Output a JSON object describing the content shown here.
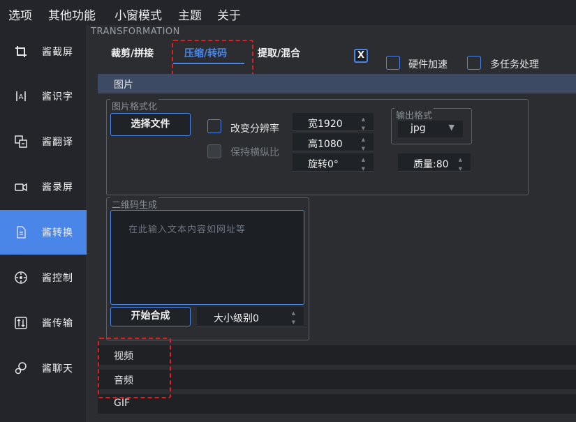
{
  "menu": [
    "选项",
    "其他功能",
    "小窗模式",
    "主题",
    "关于"
  ],
  "sidebar": {
    "items": [
      {
        "label": "酱截屏",
        "icon": "crop-icon"
      },
      {
        "label": "酱识字",
        "icon": "text-recognize-icon"
      },
      {
        "label": "酱翻译",
        "icon": "translate-icon"
      },
      {
        "label": "酱录屏",
        "icon": "video-camera-icon"
      },
      {
        "label": "酱转换",
        "icon": "file-convert-icon",
        "active": true
      },
      {
        "label": "酱控制",
        "icon": "remote-control-icon"
      },
      {
        "label": "酱传输",
        "icon": "transfer-icon"
      },
      {
        "label": "酱聊天",
        "icon": "chat-icon"
      }
    ]
  },
  "panel": {
    "title": "TRANSFORMATION",
    "tabs": [
      "裁剪/拼接",
      "压缩/转码",
      "提取/混合"
    ],
    "close_box": "X",
    "options": {
      "hardware_accel": "硬件加速",
      "multitask": "多任务处理"
    }
  },
  "sections": {
    "image": "图片",
    "video": "视频",
    "audio": "音频",
    "gif": "GIF"
  },
  "image_format": {
    "group_title": "图片格式化",
    "select_file": "选择文件",
    "change_resolution": "改变分辨率",
    "keep_ratio": "保持横纵比",
    "width": "宽1920",
    "height": "高1080",
    "rotate": "旋转0°",
    "output_group": "输出格式",
    "output_value": "jpg",
    "quality": "质量:80"
  },
  "qrcode": {
    "group_title": "二维码生成",
    "placeholder": "在此输入文本内容如网址等",
    "start": "开始合成",
    "size_level": "大小级别0"
  },
  "colors": {
    "accent": "#4a86e8",
    "annotation": "#e02020"
  }
}
